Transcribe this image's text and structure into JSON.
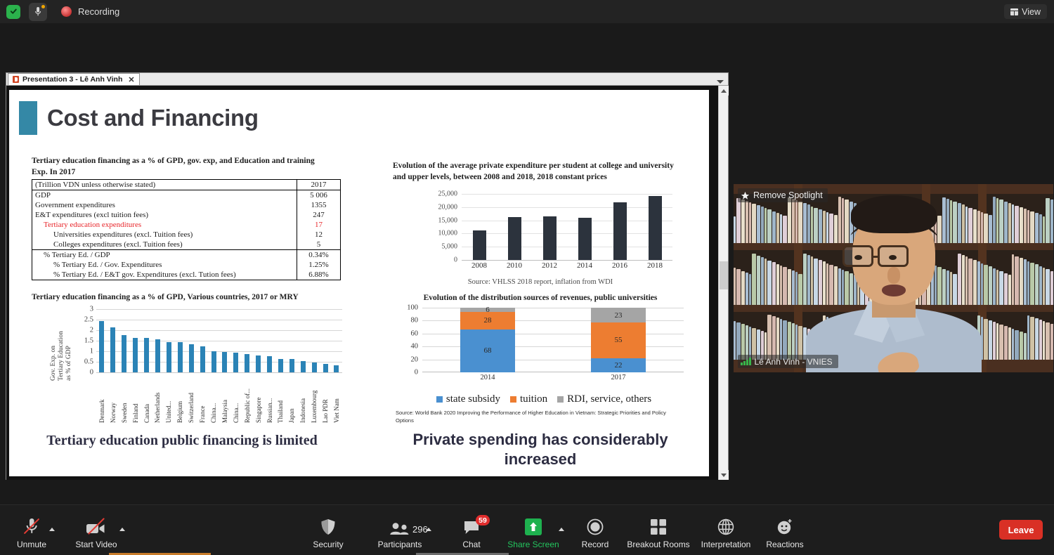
{
  "topbar": {
    "shield_icon": "shield-check-icon",
    "mic_icon": "microphone-icon",
    "recording_icon": "recording-dot-icon",
    "recording_label": "Recording",
    "view_label": "View",
    "view_icon": "grid-view-icon"
  },
  "share_window": {
    "tab_title": "Presentation 3 - Lê Anh Vinh",
    "tab_icon": "powerpoint-icon",
    "close_icon": "close-icon",
    "scroll_up_icon": "scroll-up-arrow-icon",
    "scroll_down_icon": "scroll-down-arrow-icon"
  },
  "slide": {
    "title": "Cost and Financing",
    "accent_color": "#3488a6",
    "table_caption": "Tertiary education financing as a % of GPD, gov. exp, and Education and training Exp. In 2017",
    "table": {
      "header": [
        "(Trillion VDN unless otherwise stated)",
        "2017"
      ],
      "rows": [
        {
          "label": "GDP",
          "value": "5 006",
          "indent": 0,
          "red": false
        },
        {
          "label": "Government expenditures",
          "value": "1355",
          "indent": 0,
          "red": false
        },
        {
          "label": "E&T expenditures (excl tuition fees)",
          "value": "247",
          "indent": 0,
          "red": false
        },
        {
          "label": "Tertiary education expenditures",
          "value": "17",
          "indent": 1,
          "red": true
        },
        {
          "label": "Universities expenditures (excl. Tuition fees)",
          "value": "12",
          "indent": 2,
          "red": false
        },
        {
          "label": "Colleges expenditures (excl. Tuition fees)",
          "value": "5",
          "indent": 2,
          "red": false
        },
        {
          "label": "% Tertiary Ed. / GDP",
          "value": "0.34%",
          "indent": 1,
          "red": false,
          "separator": true
        },
        {
          "label": "% Tertiary Ed. / Gov. Expenditures",
          "value": "1.25%",
          "indent": 2,
          "red": false
        },
        {
          "label": "% Tertiary Ed. / E&T gov. Expenditures (excl. Tution fees)",
          "value": "6.88%",
          "indent": 2,
          "red": false
        }
      ]
    },
    "tagline_left": "Tertiary education public financing is limited",
    "tagline_right": "Private spending has considerably increased",
    "chart2_source": "Source: VHLSS 2018 report, inflation from WDI",
    "chart3_source": "Source: World Bank 2020 Improving the Performance of Higher Education in Vietnam: Strategic Priorities and Policy Options"
  },
  "chart_data": [
    {
      "type": "bar",
      "title": "Tertiary education financing as a % of GPD, Various countries, 2017 or MRY",
      "ylabel": "Gov. Exp. on Tertiary Education as % of GDP",
      "xlabel": "",
      "ylim": [
        0,
        3
      ],
      "yticks": [
        "0",
        "0.5",
        "1",
        "1.5",
        "2",
        "2.5",
        "3"
      ],
      "grid": true,
      "bar_color": "#2b83b6",
      "categories": [
        "Denmark",
        "Norway",
        "Sweden",
        "Finland",
        "Canada",
        "Netherlands",
        "United...",
        "Belgium",
        "Switzerland",
        "France",
        "China...",
        "Malaysia",
        "China...",
        "Republic of...",
        "Singapore",
        "Russian...",
        "Thailand",
        "Japan",
        "Indonesia",
        "Luxembourg",
        "Lao PDR",
        "Viet Nam"
      ],
      "values": [
        2.45,
        2.12,
        1.78,
        1.65,
        1.65,
        1.57,
        1.45,
        1.45,
        1.35,
        1.23,
        1.01,
        0.98,
        0.94,
        0.88,
        0.81,
        0.77,
        0.64,
        0.64,
        0.55,
        0.46,
        0.4,
        0.33
      ]
    },
    {
      "type": "bar",
      "title": "Evolution of the average private expenditure per student at college and university and upper levels, between 2008 and 2018, 2018 constant prices",
      "ylabel": "",
      "xlabel": "",
      "ylim": [
        0,
        25000
      ],
      "yticks": [
        "0",
        "5,000",
        "10,000",
        "15,000",
        "20,000",
        "25,000"
      ],
      "grid": true,
      "bar_color": "#2c333d",
      "categories": [
        "2008",
        "2010",
        "2012",
        "2014",
        "2016",
        "2018"
      ],
      "values": [
        11100,
        16100,
        16400,
        15900,
        21800,
        24200
      ]
    },
    {
      "type": "bar",
      "subtype": "stacked",
      "title": "Evolution of the distribution sources of revenues, public universities",
      "ylabel": "",
      "xlabel": "",
      "ylim": [
        0,
        100
      ],
      "yticks": [
        "0",
        "20",
        "40",
        "60",
        "80",
        "100"
      ],
      "grid": true,
      "legend_position": "bottom",
      "categories": [
        "2014",
        "2017"
      ],
      "series": [
        {
          "name": "state subsidy",
          "color": "#4a90d0",
          "values": [
            68,
            22
          ]
        },
        {
          "name": "tuition",
          "color": "#ed7d31",
          "values": [
            28,
            55
          ]
        },
        {
          "name": "RDI, service, others",
          "color": "#a5a5a5",
          "values": [
            6,
            23
          ]
        }
      ]
    }
  ],
  "video": {
    "spotlight_label": "Remove Spotlight",
    "spotlight_icon": "spotlight-icon",
    "participant_name": "Lê Anh Vinh - VNIES",
    "signal_icon": "signal-bars-icon"
  },
  "toolbar": {
    "items": [
      {
        "label": "Unmute",
        "icon": "microphone-muted-icon",
        "caret": true
      },
      {
        "label": "Start Video",
        "icon": "video-camera-off-icon",
        "caret": true
      },
      {
        "label": "Security",
        "icon": "shield-icon",
        "caret": false
      },
      {
        "label": "Participants",
        "icon": "people-icon",
        "caret": true,
        "count": "296"
      },
      {
        "label": "Chat",
        "icon": "chat-bubble-icon",
        "caret": false,
        "badge": "59"
      },
      {
        "label": "Share Screen",
        "icon": "share-screen-icon",
        "caret": true
      },
      {
        "label": "Record",
        "icon": "record-circle-icon",
        "caret": false
      },
      {
        "label": "Breakout Rooms",
        "icon": "breakout-rooms-icon",
        "caret": false
      },
      {
        "label": "Interpretation",
        "icon": "globe-icon",
        "caret": false
      },
      {
        "label": "Reactions",
        "icon": "reactions-smiley-icon",
        "caret": false
      }
    ],
    "leave_label": "Leave"
  }
}
